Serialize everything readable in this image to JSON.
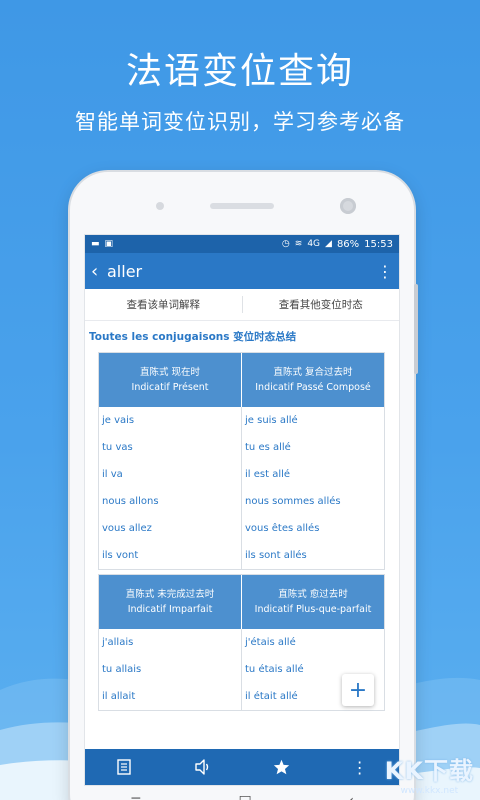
{
  "promo": {
    "title": "法语变位查询",
    "subtitle": "智能单词变位识别，学习参考必备"
  },
  "status_bar": {
    "battery": "86%",
    "time": "15:53",
    "network": "4G"
  },
  "app_bar": {
    "back_icon": "chevron-left-icon",
    "title": "aller",
    "menu_icon": "more-vertical-icon"
  },
  "tabs": [
    {
      "label": "查看该单词解释"
    },
    {
      "label": "查看其他变位时态"
    }
  ],
  "section_title": "Toutes les conjugaisons 变位时态总结",
  "tables": [
    {
      "columns": [
        {
          "zh": "直陈式 现在时",
          "fr": "Indicatif Présent",
          "forms": [
            "je vais",
            "tu vas",
            "il va",
            "nous allons",
            "vous allez",
            "ils vont"
          ]
        },
        {
          "zh": "直陈式 复合过去时",
          "fr": "Indicatif Passé Composé",
          "forms": [
            "je suis allé",
            "tu es allé",
            "il est allé",
            "nous sommes allés",
            "vous êtes allés",
            "ils sont allés"
          ]
        }
      ]
    },
    {
      "columns": [
        {
          "zh": "直陈式 未完成过去时",
          "fr": "Indicatif Imparfait",
          "forms": [
            "j'allais",
            "tu allais",
            "il allait"
          ]
        },
        {
          "zh": "直陈式 愈过去时",
          "fr": "Indicatif Plus-que-parfait",
          "forms": [
            "j'étais allé",
            "tu étais allé",
            "il était allé"
          ]
        }
      ]
    }
  ],
  "fab": {
    "icon": "plus-icon",
    "label": "+"
  },
  "bottom_bar": {
    "items": [
      {
        "icon": "notebook-icon"
      },
      {
        "icon": "speaker-icon"
      },
      {
        "icon": "star-icon"
      },
      {
        "icon": "more-vertical-icon"
      }
    ]
  },
  "nav_bar": {
    "menu": "≡",
    "home": "□",
    "back": "‹"
  },
  "watermark": {
    "main": "KK下载",
    "url": "www.kkx.net"
  },
  "colors": {
    "primary": "#2a78c6",
    "header": "#4d90cf",
    "background": "#4aa2ec"
  }
}
